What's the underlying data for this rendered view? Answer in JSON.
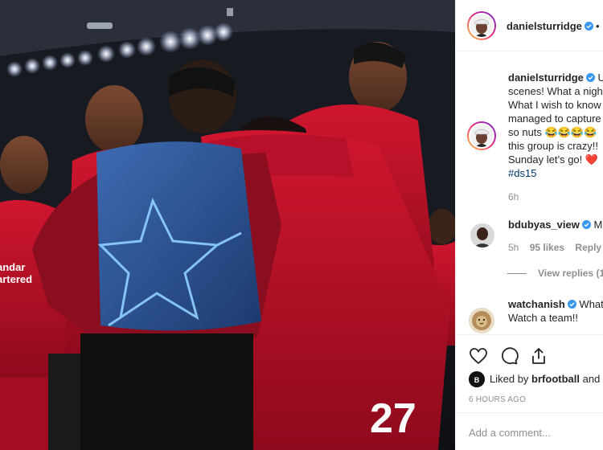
{
  "post": {
    "author": "danielsturridge",
    "header_more": "•"
  },
  "caption": {
    "username": "danielsturridge",
    "line1_tail": "U",
    "line2": "scenes! What a nigh",
    "line3": "What I wish to know",
    "line4": "managed to capture",
    "line5": "so nuts 😂😂😂😂",
    "line6": "this group is crazy!!",
    "line7": "Sunday let’s go! ❤️",
    "hashtag": "#ds15",
    "time": "6h"
  },
  "comments": [
    {
      "username": "bdubyas_view",
      "text_tail": "M",
      "time": "5h",
      "likes": "95 likes",
      "reply": "Reply",
      "view_replies": "View replies (1)"
    },
    {
      "username": "watchanish",
      "text_tail": "What",
      "line2": "Watch a team!!"
    }
  ],
  "actions": {
    "icons": [
      "heart-icon",
      "comment-icon",
      "share-icon"
    ],
    "liked_by_prefix": "Liked by",
    "liked_by_user": "brfootball",
    "liked_by_suffix": "and",
    "time_ago": "6 HOURS AGO"
  },
  "add_comment": {
    "placeholder": "Add a comment..."
  },
  "photo": {
    "shirt_number": "27",
    "sponsor_text_1": "andar",
    "sponsor_text_2": "artered"
  },
  "colors": {
    "verified": "#3897f0",
    "liverpool_red": "#c8102e",
    "bib_blue": "#2f5a9e"
  }
}
